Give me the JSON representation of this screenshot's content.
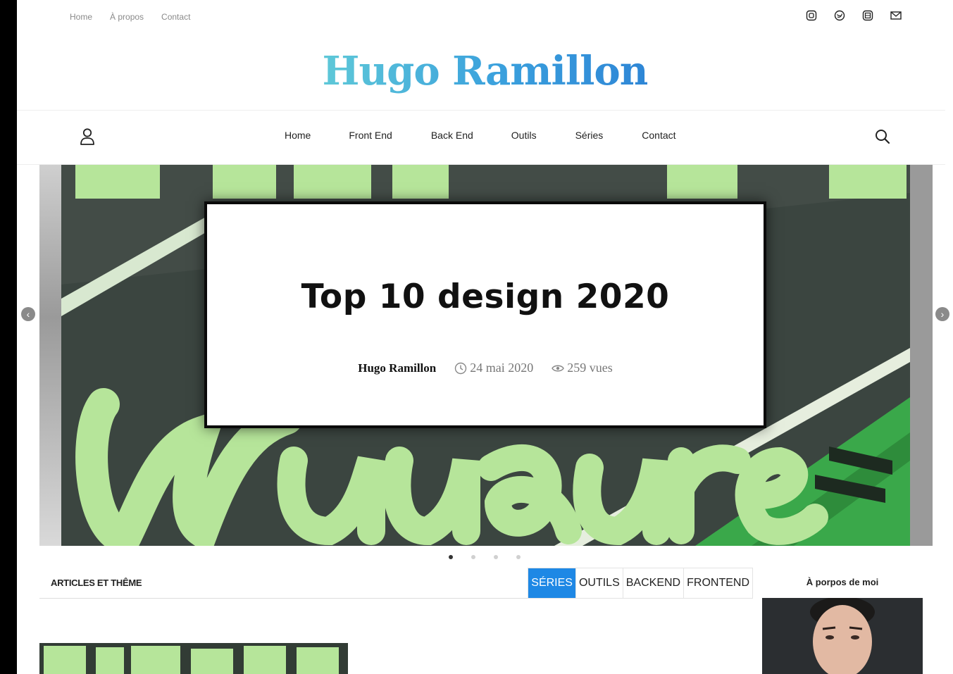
{
  "topbar": {
    "links": [
      "Home",
      "À propos",
      "Contact"
    ],
    "socials": [
      "instagram-icon",
      "twitter-icon",
      "linkedin-icon",
      "mail-icon"
    ]
  },
  "brand": {
    "title": "Hugo Ramillon"
  },
  "nav": {
    "items": [
      "Home",
      "Front End",
      "Back End",
      "Outils",
      "Séries",
      "Contact"
    ]
  },
  "slider": {
    "title": "Top 10 design 2020",
    "author": "Hugo Ramillon",
    "date": "24 mai 2020",
    "views": "259 vues",
    "dot_count": 4,
    "active_dot": 1
  },
  "articles": {
    "title": "ARTICLES ET THÊME",
    "tabs": [
      "SÉRIES",
      "OUTILS",
      "BACKEND",
      "FRONTEND"
    ],
    "active_tab": "SÉRIES"
  },
  "sidebar": {
    "about_title": "À porpos de moi"
  },
  "colors": {
    "accent": "#1e88e5",
    "brand_start": "#5ec8d8",
    "brand_end": "#2e86d6"
  }
}
